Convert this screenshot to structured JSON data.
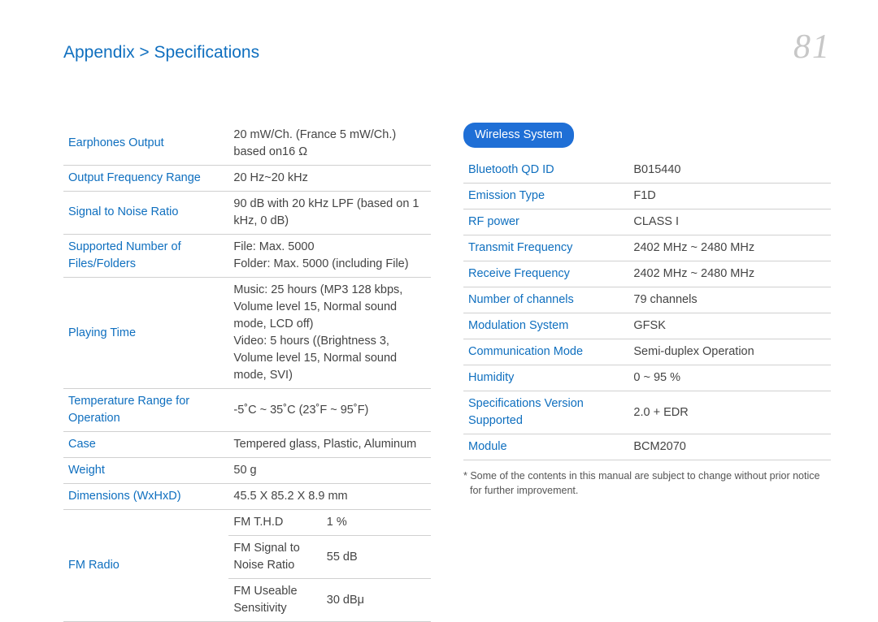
{
  "breadcrumb": {
    "main": "Appendix",
    "sep": ">",
    "sub": "Specifications"
  },
  "page_number": "81",
  "leftTable": {
    "rows": [
      {
        "label": "Earphones Output",
        "value": "20 mW/Ch. (France 5 mW/Ch.) based on16 Ω"
      },
      {
        "label": "Output Frequency Range",
        "value": "20 Hz~20 kHz"
      },
      {
        "label": "Signal to Noise Ratio",
        "value": "90 dB with 20 kHz LPF (based on 1 kHz, 0 dB)"
      },
      {
        "label": "Supported Number of Files/Folders",
        "value": "File: Max. 5000\nFolder: Max. 5000 (including File)"
      },
      {
        "label": "Playing Time",
        "value": "Music: 25 hours (MP3 128 kbps, Volume level 15, Normal sound mode, LCD off)\nVideo: 5 hours ((Brightness 3, Volume level 15, Normal sound mode, SVI)"
      },
      {
        "label": "Temperature Range for Operation",
        "value": "-5˚C ~ 35˚C (23˚F ~ 95˚F)"
      },
      {
        "label": "Case",
        "value": "Tempered glass, Plastic, Aluminum"
      },
      {
        "label": "Weight",
        "value": "50 g"
      },
      {
        "label": "Dimensions (WxHxD)",
        "value": "45.5 X 85.2 X 8.9 mm"
      }
    ],
    "fmRadioLabel": "FM Radio",
    "fmRadio": [
      {
        "label": "FM T.H.D",
        "value": "1 %"
      },
      {
        "label": "FM Signal to Noise Ratio",
        "value": "55 dB"
      },
      {
        "label": "FM Useable Sensitivity",
        "value": "30 dBμ"
      }
    ]
  },
  "right": {
    "sectionTitle": "Wireless System",
    "rows": [
      {
        "label": "Bluetooth QD ID",
        "value": "B015440"
      },
      {
        "label": "Emission Type",
        "value": "F1D"
      },
      {
        "label": "RF power",
        "value": "CLASS I"
      },
      {
        "label": "Transmit Frequency",
        "value": "2402 MHz ~ 2480 MHz"
      },
      {
        "label": "Receive Frequency",
        "value": "2402 MHz ~ 2480 MHz"
      },
      {
        "label": "Number of channels",
        "value": "79 channels"
      },
      {
        "label": "Modulation System",
        "value": "GFSK"
      },
      {
        "label": "Communication Mode",
        "value": "Semi-duplex Operation"
      },
      {
        "label": "Humidity",
        "value": "0 ~ 95 %"
      },
      {
        "label": "Specifications Version Supported",
        "value": "2.0 + EDR"
      },
      {
        "label": "Module",
        "value": "BCM2070"
      }
    ],
    "footnote": "* Some of the contents in this manual are subject to change without prior notice for further improvement."
  }
}
